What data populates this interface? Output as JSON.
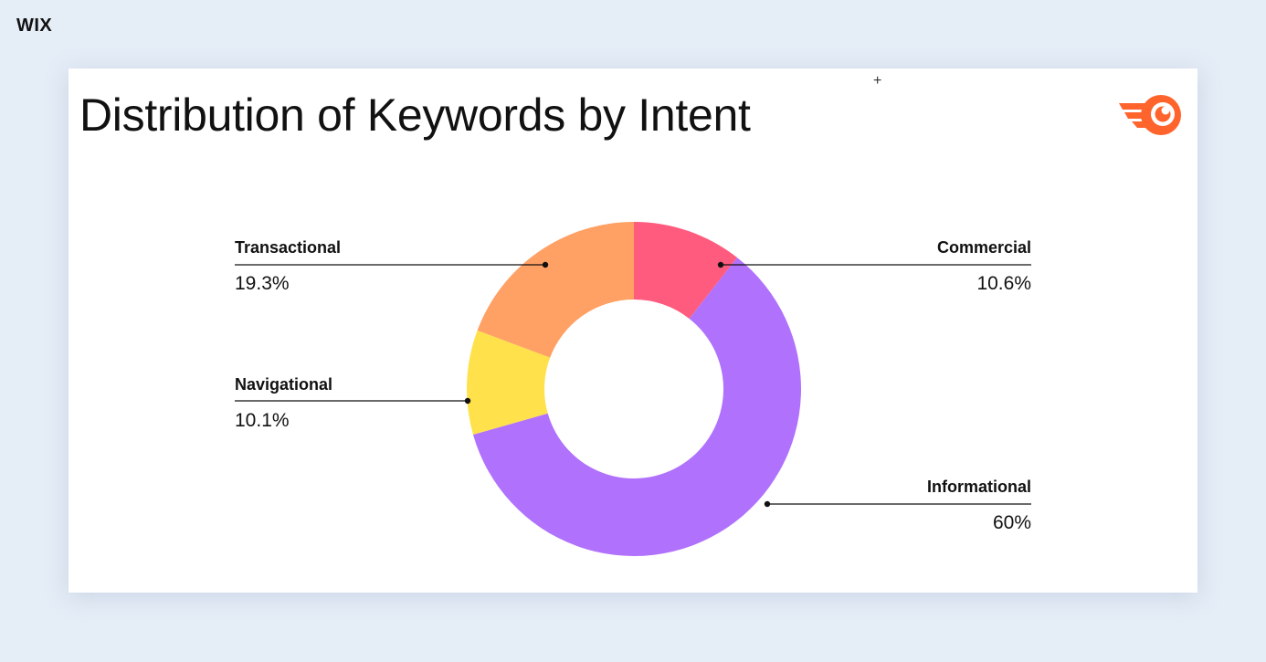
{
  "brand": "WIX",
  "cursor_glyph": "+",
  "logo_icon": "semrush-logo-icon",
  "colors": {
    "Commercial": "#ff5b7e",
    "Informational": "#b071fc",
    "Navigational": "#ffe14c",
    "Transactional": "#ffa064",
    "logo": "#ff642d",
    "leader": "#111111"
  },
  "chart_data": {
    "type": "pie",
    "style": "donut",
    "title": "Distribution of Keywords by Intent",
    "slices": [
      {
        "label": "Commercial",
        "value": 10.6,
        "display": "10.6%"
      },
      {
        "label": "Informational",
        "value": 60,
        "display": "60%"
      },
      {
        "label": "Navigational",
        "value": 10.1,
        "display": "10.1%"
      },
      {
        "label": "Transactional",
        "value": 19.3,
        "display": "19.3%"
      }
    ]
  }
}
